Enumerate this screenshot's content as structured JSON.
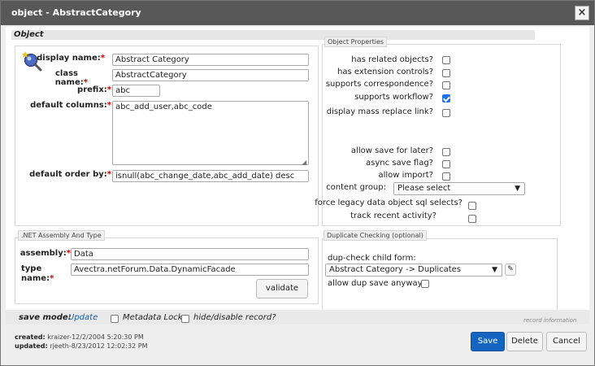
{
  "window": {
    "title": "object - AbstractCategory",
    "close_label": "×"
  },
  "section": {
    "object_label": "Object"
  },
  "object_panel": {
    "display_name_label": "display name:",
    "display_name_value": "Abstract Category",
    "class_name_label_1": "class",
    "class_name_label_2": "name:",
    "class_name_value": "AbstractCategory",
    "prefix_label": "prefix:",
    "prefix_value": "abc",
    "default_columns_label": "default columns:",
    "default_columns_value": "abc_add_user,abc_code",
    "default_order_label": "default order by:",
    "default_order_value": "isnull(abc_change_date,abc_add_date) desc",
    "required_mark": "*"
  },
  "object_properties": {
    "legend": "Object Properties",
    "items": [
      {
        "label": "has related objects?",
        "checked": false
      },
      {
        "label": "has extension controls?",
        "checked": false
      },
      {
        "label": "supports correspondence?",
        "checked": false
      },
      {
        "label": "supports workflow?",
        "checked": true
      },
      {
        "label": "display mass replace link?",
        "checked": false
      },
      {
        "label": "allow save for later?",
        "checked": false
      },
      {
        "label": "async save flag?",
        "checked": false
      },
      {
        "label": "allow import?",
        "checked": false
      }
    ],
    "content_group_label": "content group:",
    "content_group_value": "Please select",
    "force_legacy_label": "force legacy data object sql selects?",
    "track_recent_label": "track recent activity?"
  },
  "assembly": {
    "legend": ".NET Assembly And Type",
    "assembly_label": "assembly:",
    "assembly_value": "Data",
    "type_label_1": "type",
    "type_label_2": "name:",
    "type_value": "Avectra.netForum.Data.DynamicFacade",
    "validate_label": "validate"
  },
  "duplicate": {
    "legend": "Duplicate Checking (optional)",
    "child_form_label": "dup-check child form:",
    "child_form_value": "Abstract Category -> Duplicates",
    "allow_dup_label": "allow dup save anyway?"
  },
  "footer": {
    "save_mode_label": "save mode:",
    "save_mode_value": "Update",
    "metadata_lock_label": "Metadata Lock",
    "hide_record_label": "hide/disable record?",
    "record_info": "record information",
    "created_label": "created:",
    "created_value": "kraizer-12/2/2004 5:20:30 PM",
    "updated_label": "updated:",
    "updated_value": "rjeeth-8/23/2012 12:02:32 PM",
    "save_label": "Save",
    "delete_label": "Delete",
    "cancel_label": "Cancel"
  }
}
